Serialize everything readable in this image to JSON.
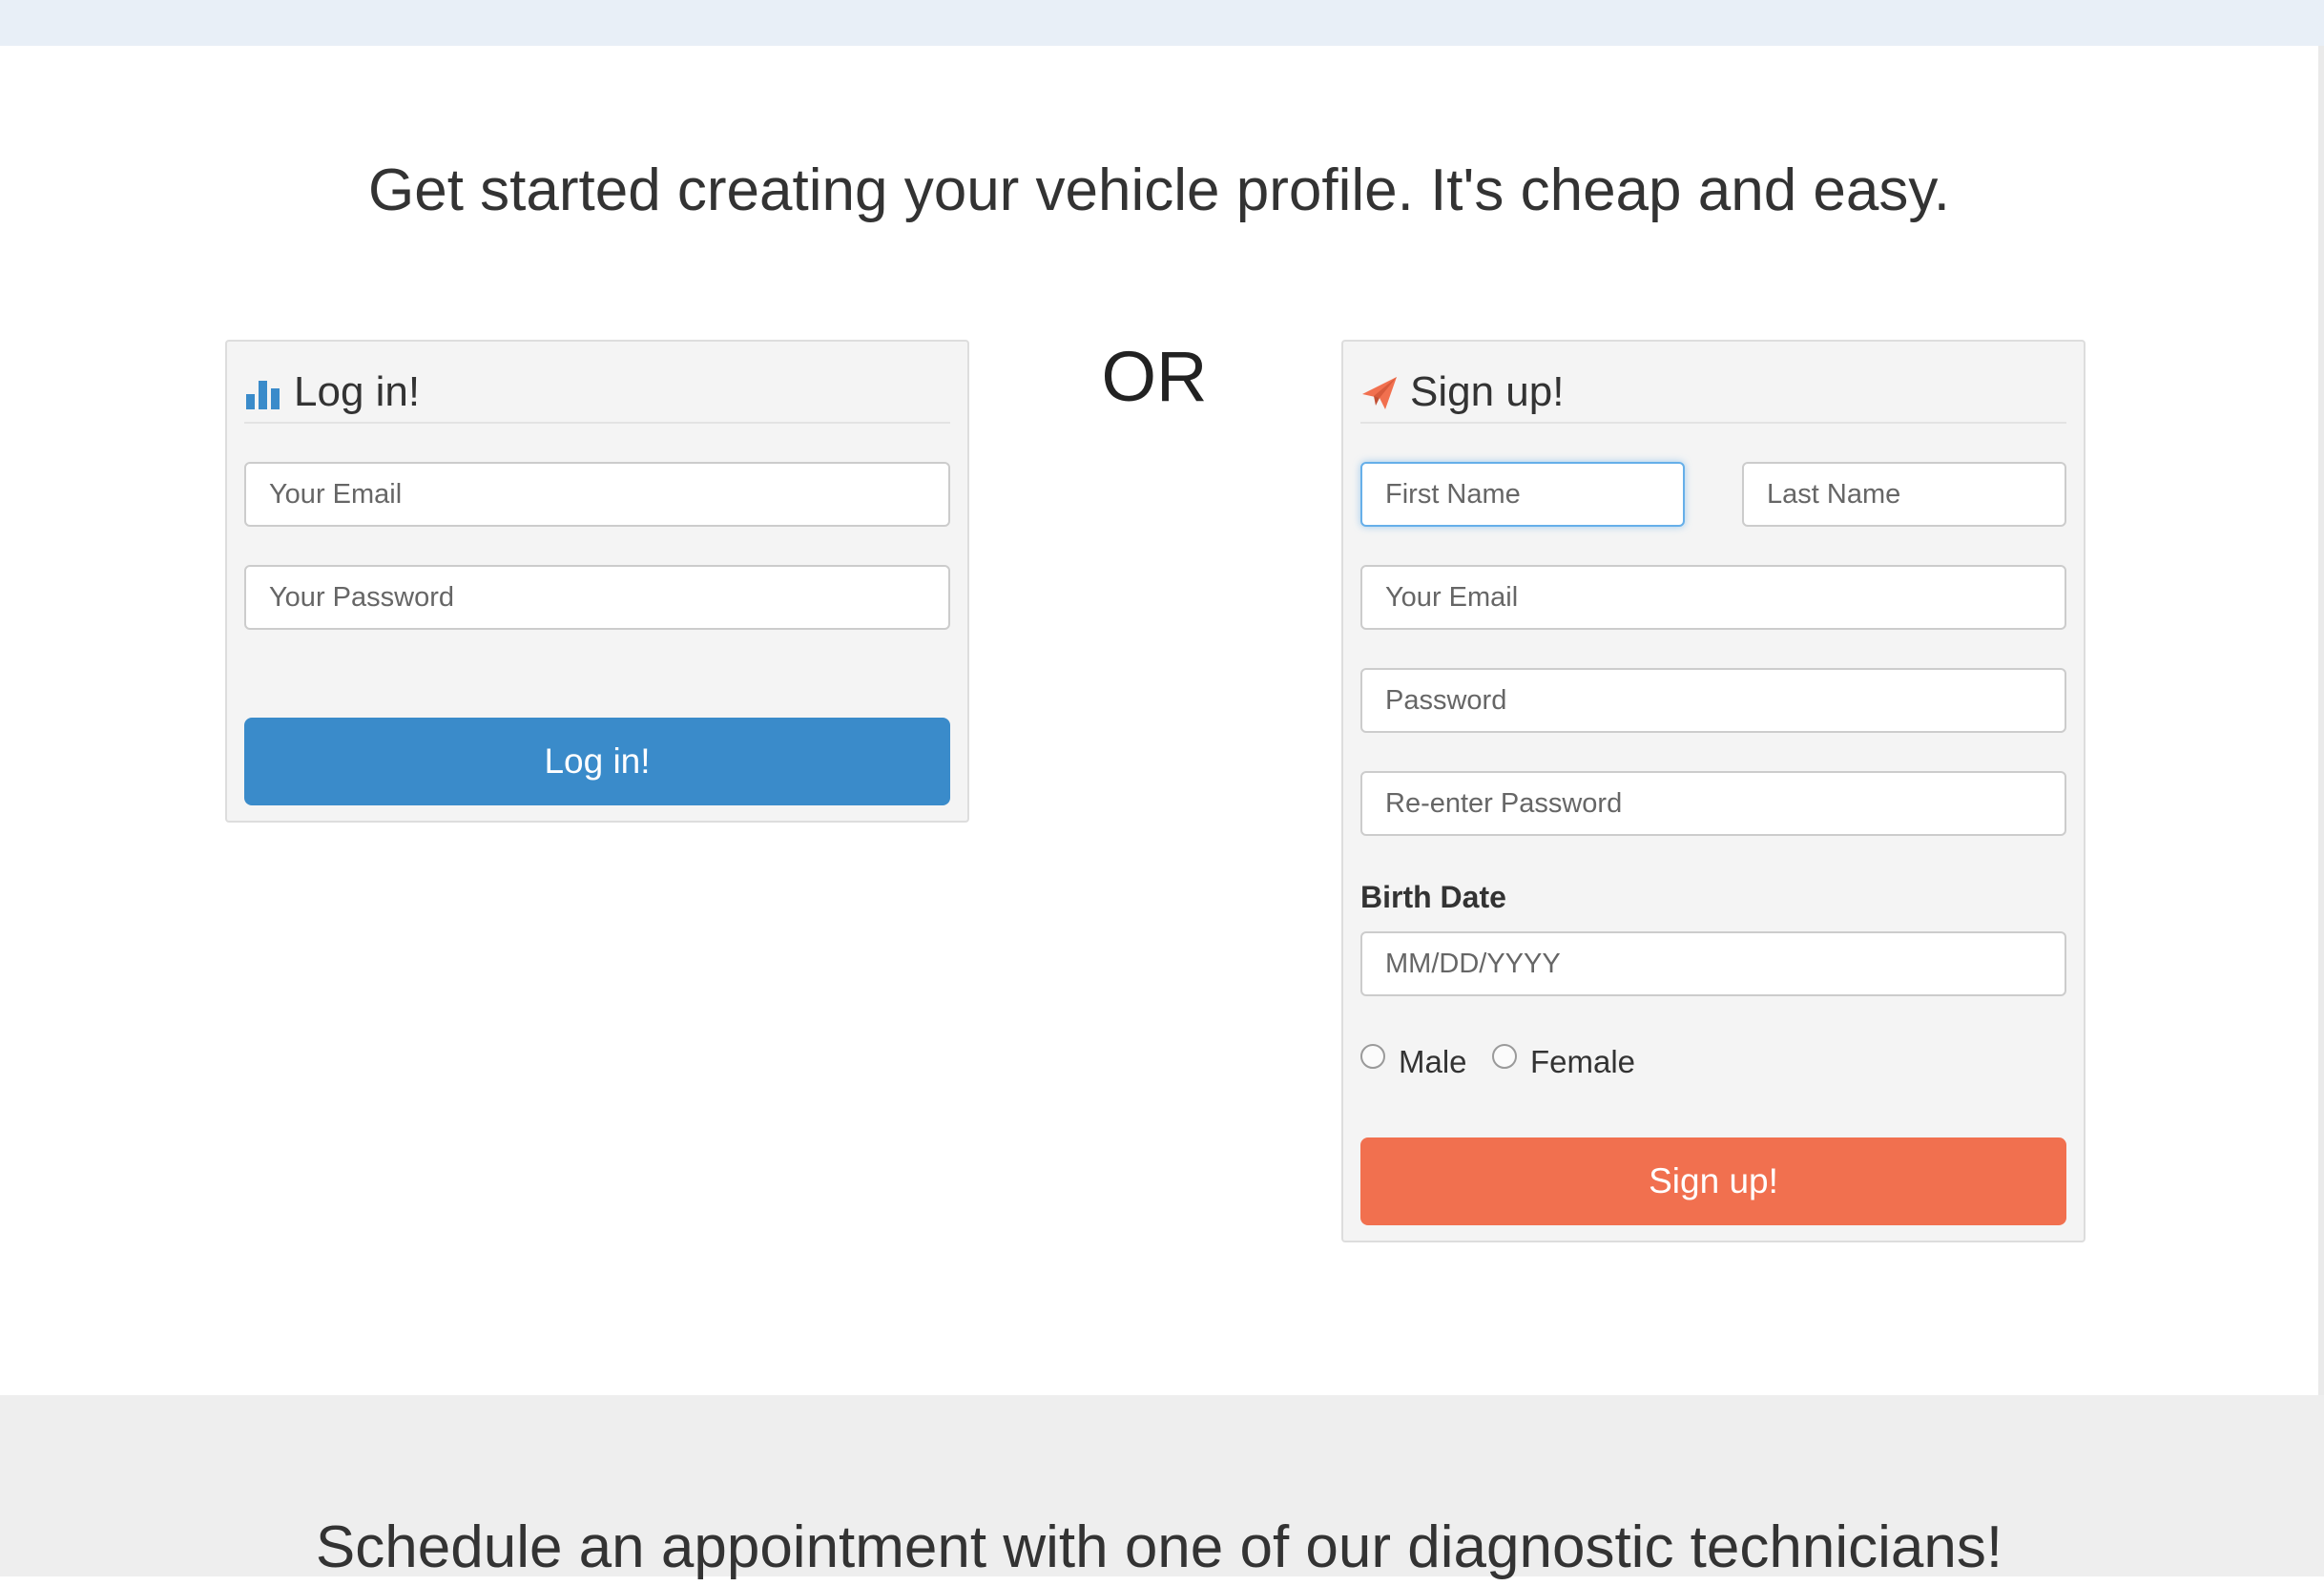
{
  "headline": "Get started creating your vehicle profile. It's cheap and easy.",
  "divider_text": "OR",
  "login": {
    "title": "Log in!",
    "title_icon": "bar-chart-icon",
    "email_placeholder": "Your Email",
    "password_placeholder": "Your Password",
    "button_label": "Log in!",
    "accent_color": "#3a8bca"
  },
  "signup": {
    "title": "Sign up!",
    "title_icon": "paper-plane-icon",
    "first_name_placeholder": "First Name",
    "last_name_placeholder": "Last Name",
    "email_placeholder": "Your Email",
    "password_placeholder": "Password",
    "reenter_password_placeholder": "Re-enter Password",
    "birth_date_label": "Birth Date",
    "birth_date_placeholder": "MM/DD/YYYY",
    "gender_options": [
      "Male",
      "Female"
    ],
    "button_label": "Sign up!",
    "accent_color": "#f1704f"
  },
  "footer": {
    "headline": "Schedule an appointment with one of our diagnostic technicians!"
  }
}
